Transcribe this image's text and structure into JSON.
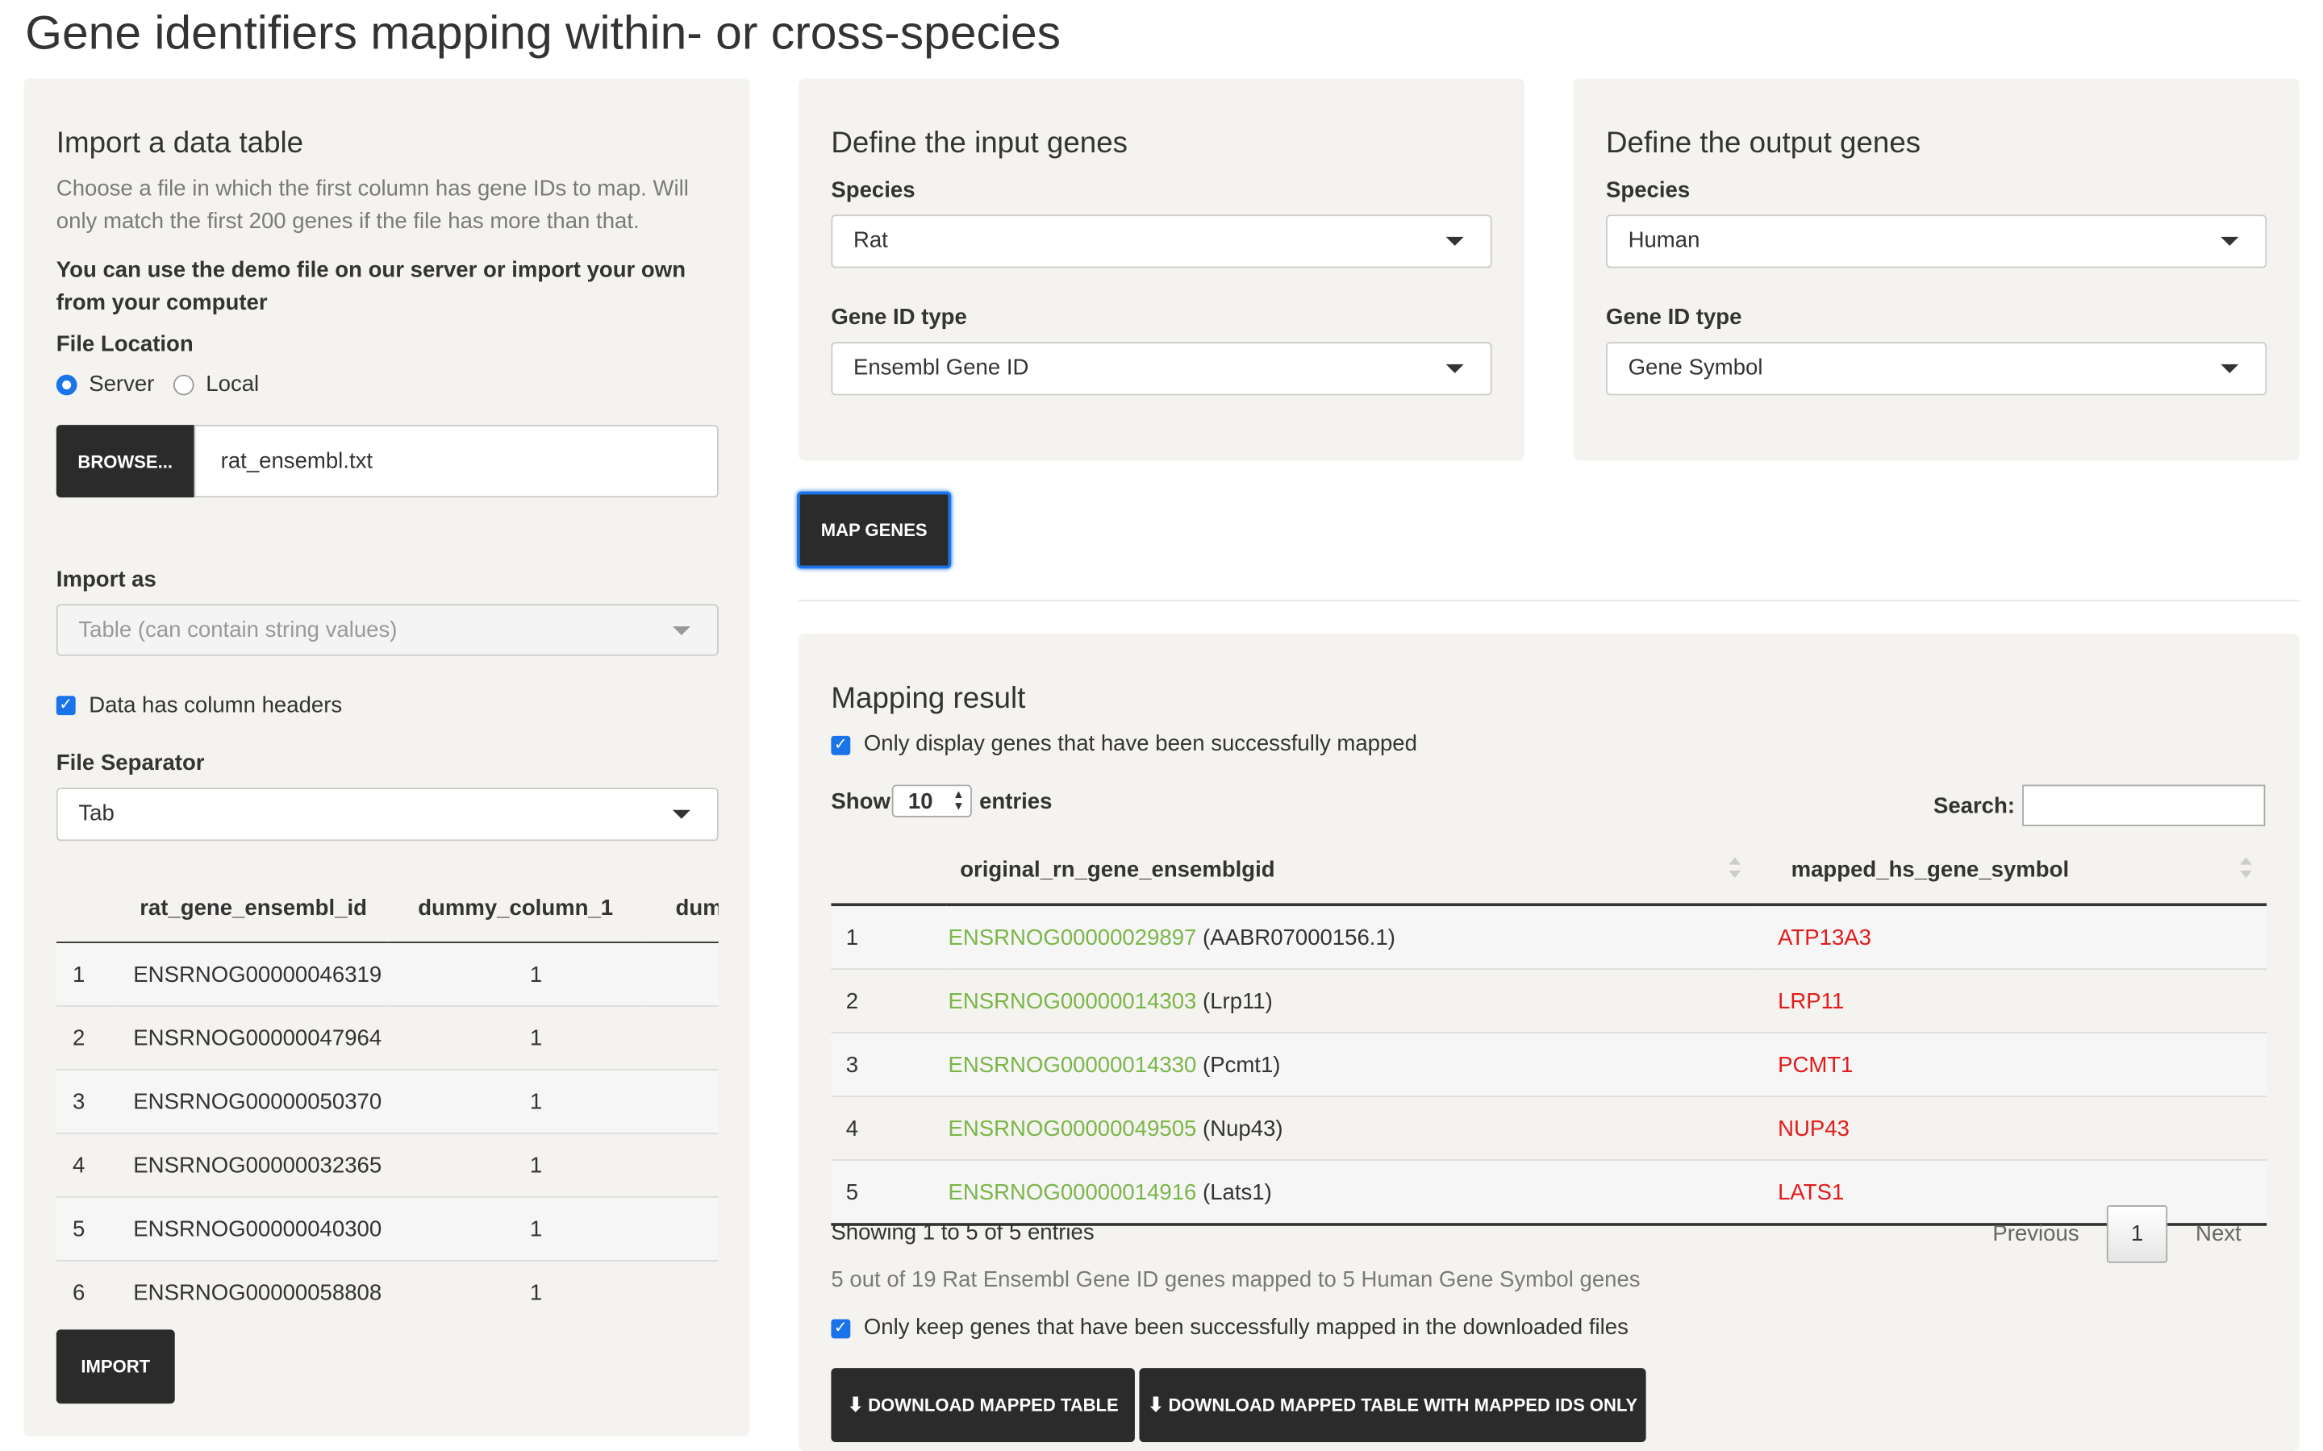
{
  "page_title": "Gene identifiers mapping within- or cross-species",
  "import_panel": {
    "heading": "Import a data table",
    "help": "Choose a file in which the first column has gene IDs to map. Will only match the first 200 genes if the file has more than that.",
    "demo_note": "You can use the demo file on our server or import your own from your computer",
    "file_location_label": "File Location",
    "radio_server": "Server",
    "radio_local": "Local",
    "browse_label": "BROWSE...",
    "file_name": "rat_ensembl.txt",
    "import_as_label": "Import as",
    "import_as_value": "Table (can contain string values)",
    "header_checkbox_label": "Data has column headers",
    "separator_label": "File Separator",
    "separator_value": "Tab",
    "preview": {
      "columns": [
        "",
        "rat_gene_ensembl_id",
        "dummy_column_1",
        "dumn"
      ],
      "rows": [
        [
          "1",
          "ENSRNOG00000046319",
          "1"
        ],
        [
          "2",
          "ENSRNOG00000047964",
          "1"
        ],
        [
          "3",
          "ENSRNOG00000050370",
          "1"
        ],
        [
          "4",
          "ENSRNOG00000032365",
          "1"
        ],
        [
          "5",
          "ENSRNOG00000040300",
          "1"
        ],
        [
          "6",
          "ENSRNOG00000058808",
          "1"
        ]
      ]
    },
    "import_button": "IMPORT"
  },
  "input_panel": {
    "heading": "Define the input genes",
    "species_label": "Species",
    "species_value": "Rat",
    "idtype_label": "Gene ID type",
    "idtype_value": "Ensembl Gene ID"
  },
  "output_panel": {
    "heading": "Define the output genes",
    "species_label": "Species",
    "species_value": "Human",
    "idtype_label": "Gene ID type",
    "idtype_value": "Gene Symbol"
  },
  "map_button": "MAP GENES",
  "result_panel": {
    "heading": "Mapping result",
    "only_display_label": "Only display genes that have been successfully mapped",
    "show_label": "Show",
    "entries_value": "10",
    "entries_label": "entries",
    "search_label": "Search:",
    "columns": [
      "",
      "original_rn_gene_ensemblgid",
      "mapped_hs_gene_symbol"
    ],
    "rows": [
      {
        "n": "1",
        "id": "ENSRNOG00000029897",
        "name": "(AABR07000156.1)",
        "symbol": "ATP13A3"
      },
      {
        "n": "2",
        "id": "ENSRNOG00000014303",
        "name": "(Lrp11)",
        "symbol": "LRP11"
      },
      {
        "n": "3",
        "id": "ENSRNOG00000014330",
        "name": "(Pcmt1)",
        "symbol": "PCMT1"
      },
      {
        "n": "4",
        "id": "ENSRNOG00000049505",
        "name": "(Nup43)",
        "symbol": "NUP43"
      },
      {
        "n": "5",
        "id": "ENSRNOG00000014916",
        "name": "(Lats1)",
        "symbol": "LATS1"
      }
    ],
    "showing_text": "Showing 1 to 5 of 5 entries",
    "previous_label": "Previous",
    "page_number": "1",
    "next_label": "Next",
    "summary_text": "5 out of 19 Rat Ensembl Gene ID genes mapped to 5 Human Gene Symbol genes",
    "keep_mapped_label": "Only keep genes that have been successfully mapped in the downloaded files",
    "download_button": "DOWNLOAD MAPPED TABLE",
    "download_ids_button": "DOWNLOAD MAPPED TABLE WITH MAPPED IDS ONLY"
  },
  "colors": {
    "accent": "#1a73e8",
    "button": "#2b2b2b",
    "well": "#f5f3ef",
    "id_link": "#7ab648",
    "mapped_symbol": "#e21b1b"
  }
}
